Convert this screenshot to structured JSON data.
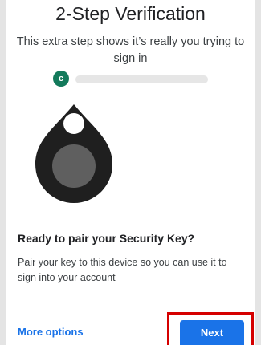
{
  "page": {
    "title": "2-Step Verification",
    "subtitle": "This extra step shows it’s really you trying to sign in"
  },
  "account": {
    "avatar_letter": "c",
    "avatar_color": "#137a5b"
  },
  "illustration": {
    "icon": "security-key-icon"
  },
  "content": {
    "heading": "Ready to pair your Security Key?",
    "body": "Pair your key to this device so you can use it to sign into your account"
  },
  "actions": {
    "more_options_label": "More options",
    "next_label": "Next",
    "accent_color": "#1a73e8",
    "highlight_color": "#d50000"
  }
}
